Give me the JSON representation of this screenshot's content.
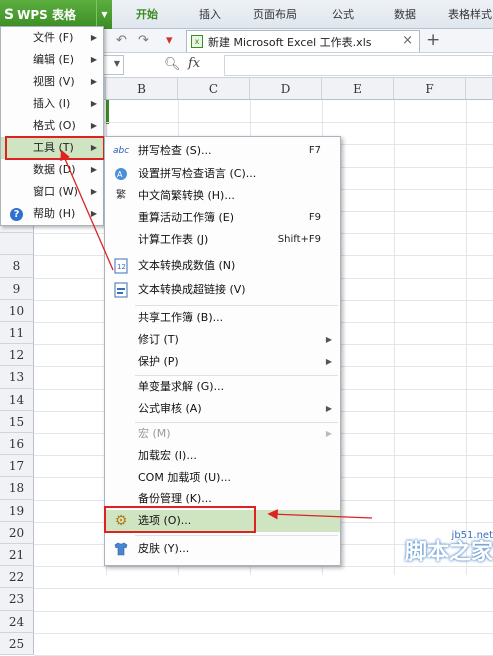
{
  "app": {
    "logo": "WPS 表格",
    "tabs": [
      "开始",
      "插入",
      "页面布局",
      "公式",
      "数据",
      "表格样式"
    ],
    "document_tab": "新建 Microsoft Excel 工作表.xls"
  },
  "formula_bar": {
    "fx_label": "fx"
  },
  "grid": {
    "columns": [
      "B",
      "C",
      "D",
      "E",
      "F"
    ],
    "rows": [
      "8",
      "9",
      "10",
      "11",
      "12",
      "13",
      "14",
      "15",
      "16",
      "17",
      "18",
      "19",
      "20",
      "21",
      "22",
      "23",
      "24",
      "25"
    ]
  },
  "main_menu": {
    "items": [
      {
        "label": "文件 (F)"
      },
      {
        "label": "编辑 (E)"
      },
      {
        "label": "视图 (V)"
      },
      {
        "label": "插入 (I)"
      },
      {
        "label": "格式 (O)"
      },
      {
        "label": "工具 (T)"
      },
      {
        "label": "数据 (D)"
      },
      {
        "label": "窗口 (W)"
      },
      {
        "label": "帮助 (H)"
      }
    ]
  },
  "tools_submenu": {
    "items": [
      {
        "label": "拼写检查 (S)...",
        "shortcut": "F7",
        "icon": "abc-spellcheck-icon",
        "icon_text": "abc"
      },
      {
        "label": "设置拼写检查语言 (C)...",
        "icon": "language-icon"
      },
      {
        "label": "中文简繁转换 (H)...",
        "icon": "traditional-simplified-icon"
      },
      {
        "label": "重算活动工作簿 (E)",
        "shortcut": "F9"
      },
      {
        "label": "计算工作表 (J)",
        "shortcut": "Shift+F9"
      },
      {
        "label": "文本转换成数值 (N)",
        "icon": "text-to-number-icon"
      },
      {
        "label": "文本转换成超链接 (V)",
        "icon": "text-to-hyperlink-icon"
      },
      {
        "label": "共享工作簿 (B)..."
      },
      {
        "label": "修订 (T)"
      },
      {
        "label": "保护 (P)"
      },
      {
        "label": "单变量求解 (G)..."
      },
      {
        "label": "公式审核 (A)"
      },
      {
        "label": "宏 (M)"
      },
      {
        "label": "加载宏 (I)..."
      },
      {
        "label": "COM 加载项 (U)..."
      },
      {
        "label": "备份管理 (K)..."
      },
      {
        "label": "选项 (O)...",
        "icon": "gear-icon"
      },
      {
        "label": "皮肤 (Y)...",
        "icon": "shirt-icon"
      }
    ]
  },
  "watermark": {
    "url": "jb51.net",
    "name": "脚本之家"
  },
  "colors": {
    "accent_green": "#3b8c23",
    "highlight_red": "#d22222",
    "menu_highlight": "#cfe4c0"
  }
}
